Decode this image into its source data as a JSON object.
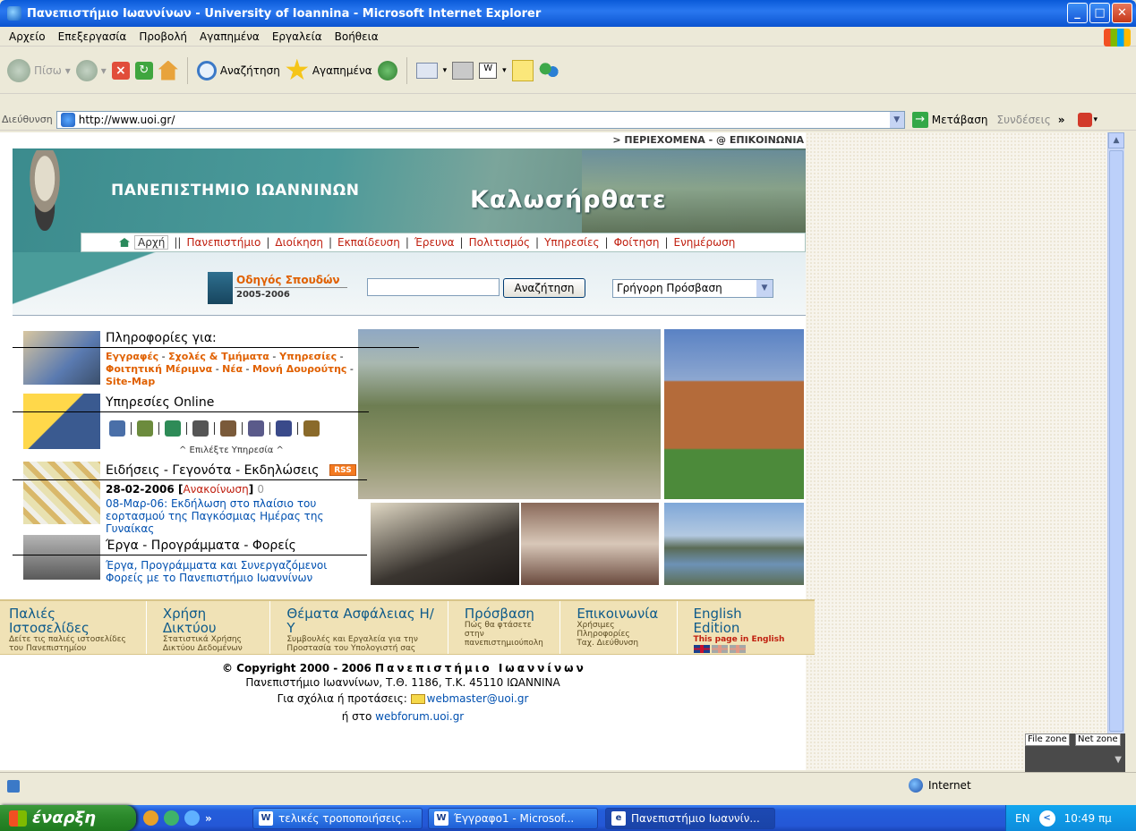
{
  "window": {
    "title": "Πανεπιστήμιο Ιωαννίνων - University of Ioannina - Microsoft Internet Explorer",
    "buttons": {
      "minimize": "_",
      "maximize": "□",
      "close": "✕"
    }
  },
  "menu": [
    "Αρχείο",
    "Επεξεργασία",
    "Προβολή",
    "Αγαπημένα",
    "Εργαλεία",
    "Βοήθεια"
  ],
  "toolbar": {
    "back": "Πίσω",
    "search": "Αναζήτηση",
    "favorites": "Αγαπημένα"
  },
  "address": {
    "label": "Διεύθυνση",
    "url": "http://www.uoi.gr/",
    "go": "Μετάβαση",
    "links": "Συνδέσεις",
    "more": "»"
  },
  "page": {
    "top_links": "> ΠΕΡΙΕΧΟΜΕΝΑ - @ ΕΠΙΚΟΙΝΩΝΙΑ",
    "uni_name": "ΠΑΝΕΠΙΣΤΗΜΙΟ ΙΩΑΝΝΙΝΩΝ",
    "welcome": "Καλωσήρθατε",
    "nav": {
      "home": "Αρχή",
      "items": [
        "Πανεπιστήμιο",
        "Διοίκηση",
        "Εκπαίδευση",
        "Έρευνα",
        "Πολιτισμός",
        "Υπηρεσίες",
        "Φοίτηση",
        "Ενημέρωση"
      ]
    },
    "guide": {
      "title": "Οδηγός Σπουδών",
      "year": "2005-2006"
    },
    "search_button": "Αναζήτηση",
    "quick_access": "Γρήγορη Πρόσβαση",
    "info": {
      "title": "Πληροφορίες για:",
      "links": [
        "Εγγραφές",
        "Σχολές & Τμήματα",
        "Υπηρεσίες",
        "Φοιτητική Μέριμνα",
        "Νέα",
        "Μονή Δουρούτης",
        "Site-Map"
      ]
    },
    "online": {
      "title": "Υπηρεσίες Online",
      "choose": "^ Επιλέξτε Υπηρεσία ^"
    },
    "news": {
      "title": "Ειδήσεις - Γεγονότα - Εκδηλώσεις",
      "rss": "RSS",
      "date": "28-02-2006",
      "type": "Ανακοίνωση",
      "count": "0",
      "text": "08-Μαρ-06: Εκδήλωση στο πλαίσιο του εορτασμού της Παγκόσμιας Ημέρας της Γυναίκας"
    },
    "projects": {
      "title": "Έργα - Προγράμματα - Φορείς",
      "text": "Έργα, Προγράμματα και Συνεργαζόμενοι Φορείς με το Πανεπιστήμιο Ιωαννίνων"
    },
    "footer_cols": [
      {
        "h": "Παλιές Ιστοσελίδες",
        "s1": "Δείτε τις παλιές ιστοσελίδες",
        "s2": "του Πανεπιστημίου"
      },
      {
        "h": "Χρήση Δικτύου",
        "s1": "Στατιστικά Χρήσης",
        "s2": "Δικτύου Δεδομένων"
      },
      {
        "h": "Θέματα Ασφάλειας Η/Υ",
        "s1": "Συμβουλές και Εργαλεία για την",
        "s2": "Προστασία του Υπολογιστή σας"
      },
      {
        "h": "Πρόσβαση",
        "s1": "Πώς θα φτάσετε στην",
        "s2": "πανεπιστημιούπολη"
      },
      {
        "h": "Επικοινωνία",
        "s1": "Χρήσιμες Πληροφορίες",
        "s2": "Ταχ. Διεύθυνση"
      },
      {
        "h": "English Edition",
        "s1": "This page in English",
        "s2": ""
      }
    ],
    "copyright_prefix": "© Copyright 2000 - 2006",
    "copyright_name": "Πανεπιστήμιο Ιωαννίνων",
    "postal": "Πανεπιστήμιο Ιωαννίνων, Τ.Θ. 1186, Τ.Κ. 45110 ΙΩΑΝΝΙΝΑ",
    "comments_label": "Για σχόλια ή προτάσεις:",
    "webmaster": "webmaster@uoi.gr",
    "forum_prefix": "ή στο",
    "forum": "webforum.uoi.gr"
  },
  "zones": {
    "file": "File zone",
    "net": "Net zone"
  },
  "status": {
    "zone": "Internet"
  },
  "taskbar": {
    "start": "έναρξη",
    "tasks": [
      "τελικές τροποποιήσεις...",
      "Έγγραφο1 - Microsof...",
      "Πανεπιστήμιο Ιωαννίν..."
    ],
    "more": "»",
    "lang": "EN",
    "time": "10:49 πμ"
  }
}
